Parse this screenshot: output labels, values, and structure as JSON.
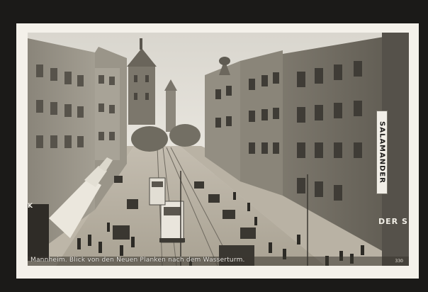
{
  "postcard": {
    "caption": "Mannheim.  Blick von den Neuen Planken nach dem Wasserturm.",
    "card_number": "330"
  },
  "signs": {
    "salamander": "SALAMANDER",
    "der": "DER S",
    "left_shop": "K"
  },
  "colors": {
    "frame": "#1b1a18",
    "card_border": "#f4f1ea",
    "sky": "#e4e1da",
    "street": "#b5ae9f"
  }
}
